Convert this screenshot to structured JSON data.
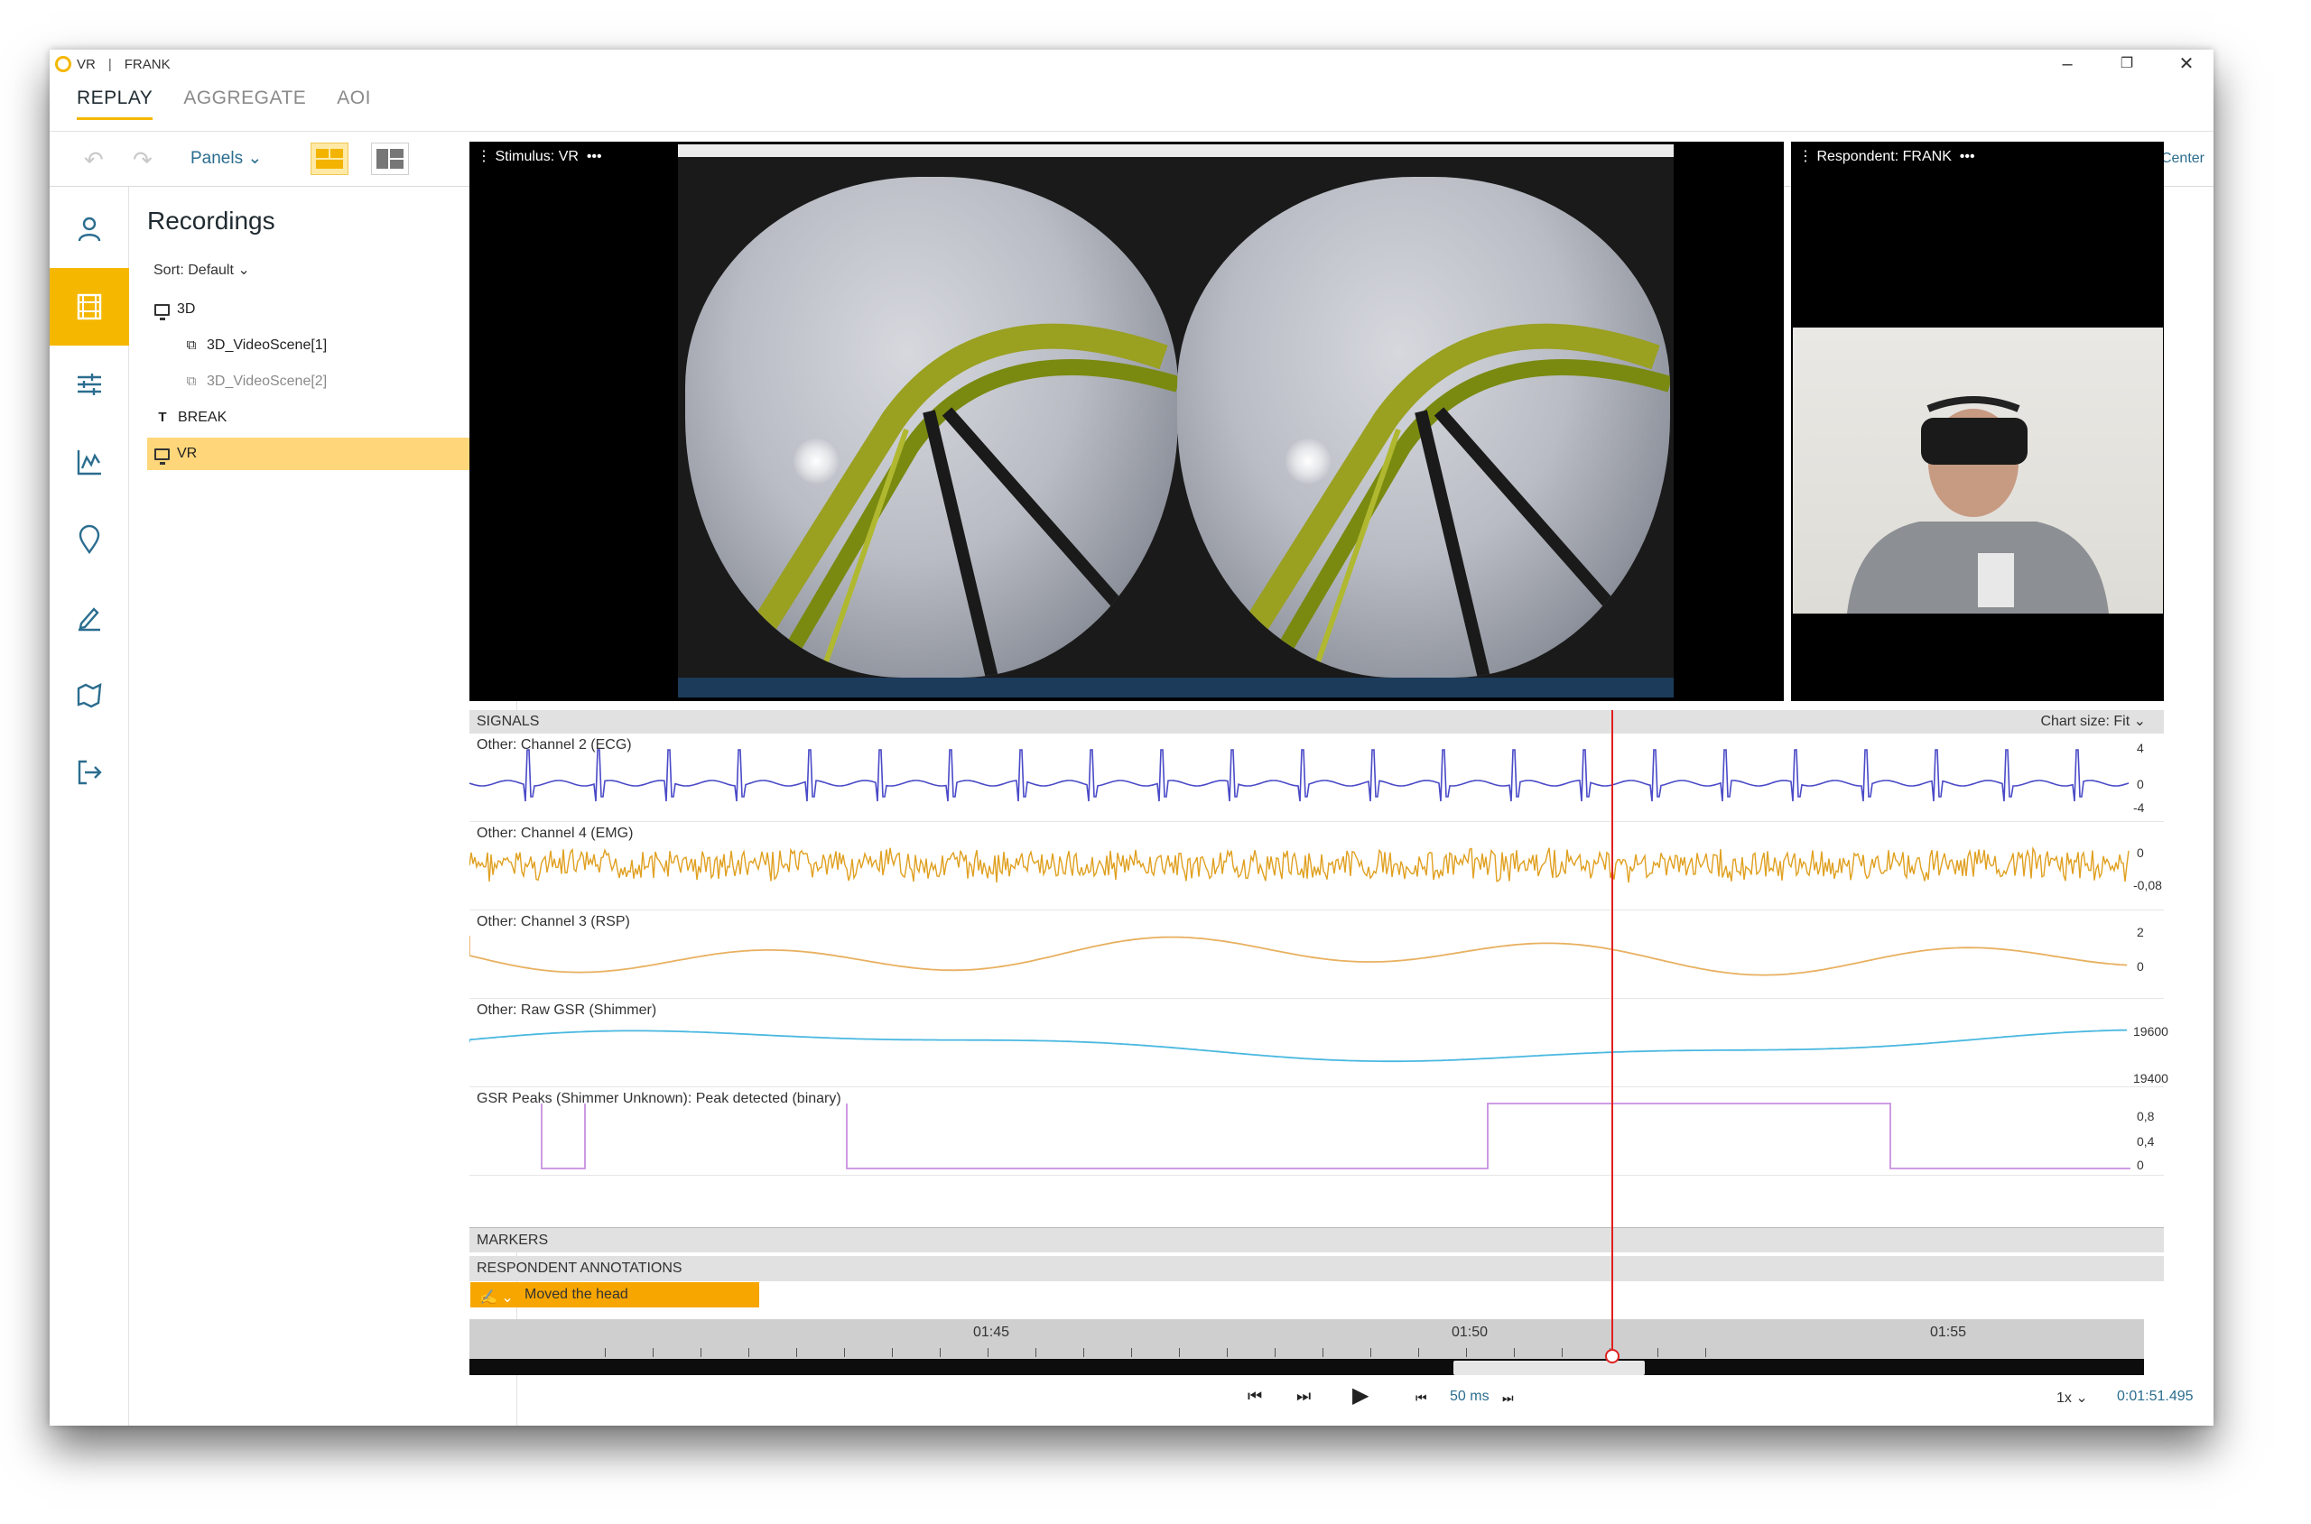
{
  "titlebar": {
    "study": "VR",
    "separator": "|",
    "respondent": "FRANK"
  },
  "tabs": [
    {
      "label": "REPLAY",
      "active": true
    },
    {
      "label": "AGGREGATE",
      "active": false
    },
    {
      "label": "AOI",
      "active": false
    }
  ],
  "toolbar": {
    "panels_label": "Panels",
    "help_label": "View Help Center"
  },
  "rail": [
    "person-icon",
    "film-icon",
    "sliders-icon",
    "chart-icon",
    "pin-icon",
    "pencil-icon",
    "map-icon",
    "exit-icon"
  ],
  "recordings": {
    "title": "Recordings",
    "sort_label": "Sort: Default",
    "items": [
      {
        "label": "3D",
        "icon": "monitor-icon",
        "level": 0
      },
      {
        "label": "3D_VideoScene[1]",
        "icon": "video-scene-icon",
        "level": 1
      },
      {
        "label": "3D_VideoScene[2]",
        "icon": "video-scene-icon",
        "level": 1
      },
      {
        "label": "BREAK",
        "icon": "text-icon",
        "level": 0
      },
      {
        "label": "VR",
        "icon": "monitor-icon",
        "level": 0,
        "selected": true
      }
    ]
  },
  "stimulus": {
    "label": "Stimulus: VR",
    "menu": "•••"
  },
  "respondent_panel": {
    "label": "Respondent: FRANK",
    "menu": "•••"
  },
  "signals": {
    "header": "SIGNALS",
    "chart_size": "Chart size:  Fit",
    "rows": [
      {
        "label": "Other: Channel 2 (ECG)",
        "ticks": [
          "4",
          "0",
          "-4"
        ],
        "color": "#4a4ac8"
      },
      {
        "label": "Other: Channel 4 (EMG)",
        "ticks": [
          "0",
          "-0,08"
        ],
        "color": "#e0a020"
      },
      {
        "label": "Other: Channel 3 (RSP)",
        "ticks": [
          "2",
          "0"
        ],
        "color": "#e8b060"
      },
      {
        "label": "Other: Raw GSR (Shimmer)",
        "ticks": [
          "19600",
          "19400"
        ],
        "color": "#4ab8e0"
      },
      {
        "label": "GSR Peaks (Shimmer Unknown): Peak detected (binary)",
        "ticks": [
          "0,8",
          "0,4",
          "0"
        ],
        "color": "#c890e0"
      }
    ]
  },
  "markers": {
    "header": "MARKERS"
  },
  "annotations": {
    "header": "RESPONDENT ANNOTATIONS",
    "item": "Moved the head"
  },
  "timeline": {
    "labels": [
      "01:45",
      "01:50",
      "01:55"
    ]
  },
  "transport": {
    "step": "50 ms",
    "speed": "1x",
    "time": "0:01:51.495"
  }
}
